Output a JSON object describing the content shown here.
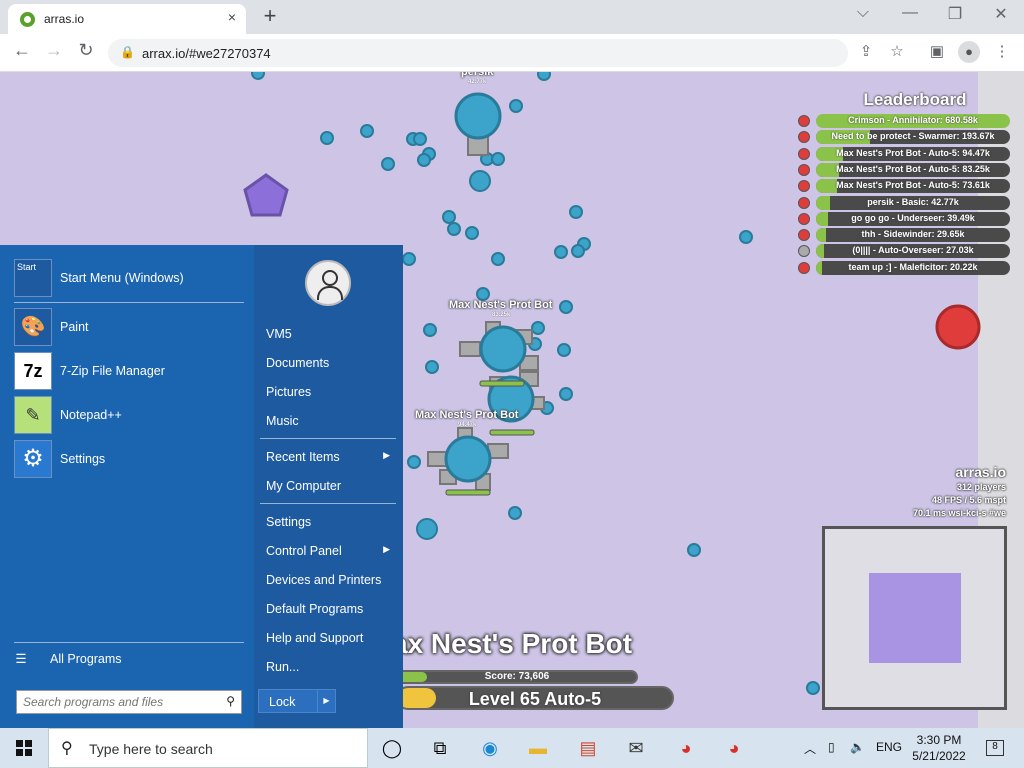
{
  "browser": {
    "tab_title": "arras.io",
    "tab_close": "×",
    "new_tab": "+",
    "url": "arrax.io/#we27270374",
    "window_controls": [
      "⌵",
      "—",
      "❐",
      "✕"
    ]
  },
  "game": {
    "leaderboard": {
      "title": "Leaderboard",
      "entries": [
        {
          "label": "Crimson - Annihilator: 680.58k",
          "fill": 1.0,
          "color": "#e03c3c"
        },
        {
          "label": "Need to be protect - Swarmer: 193.67k",
          "fill": 0.28,
          "color": "#e03c3c"
        },
        {
          "label": "Max Nest's Prot Bot - Auto-5: 94.47k",
          "fill": 0.14,
          "color": "#e03c3c"
        },
        {
          "label": "Max Nest's Prot Bot - Auto-5: 83.25k",
          "fill": 0.12,
          "color": "#e03c3c"
        },
        {
          "label": "Max Nest's Prot Bot - Auto-5: 73.61k",
          "fill": 0.11,
          "color": "#e03c3c"
        },
        {
          "label": "persik - Basic: 42.77k",
          "fill": 0.07,
          "color": "#e03c3c"
        },
        {
          "label": "go go go - Underseer: 39.49k",
          "fill": 0.06,
          "color": "#e03c3c"
        },
        {
          "label": "thh - Sidewinder: 29.65k",
          "fill": 0.05,
          "color": "#e03c3c"
        },
        {
          "label": "(0|||| - Auto-Overseer: 27.03k",
          "fill": 0.04,
          "color": "#aaaaaa"
        },
        {
          "label": "team up :] - Maleficitor: 20.22k",
          "fill": 0.03,
          "color": "#e03c3c"
        }
      ]
    },
    "server": {
      "name": "arras.io",
      "players": "312 players",
      "fps": "48 FPS / 5.6 mspt",
      "latency": "70.1 ms  wsi-kci-s #we"
    },
    "player": {
      "name": "ax Nest's Prot Bot",
      "score": "Score: 73,606",
      "level": "Level 65 Auto-5",
      "score_fill": 0.12,
      "level_fill": 0.14
    },
    "labels": {
      "persik_name": "persik",
      "persik_score": "42.77k",
      "bot1_name": "Max Nest's Prot Bot",
      "bot1_score": "83.25k",
      "bot2_name": "Max Nest's Prot Bot",
      "bot2_score": "94.47k"
    }
  },
  "start_menu": {
    "apps": [
      {
        "label": "Start Menu (Windows)",
        "icon": "start-menu-icon"
      },
      {
        "label": "Paint",
        "icon": "paint-icon"
      },
      {
        "label": "7-Zip File Manager",
        "icon": "7zip-icon"
      },
      {
        "label": "Notepad++",
        "icon": "notepad-icon"
      },
      {
        "label": "Settings",
        "icon": "gear-icon"
      }
    ],
    "start_icon_text": "Start",
    "sevenzip_icon_text": "7z",
    "all_programs": "All Programs",
    "search_placeholder": "Search programs and files",
    "right_items": {
      "user": "VM5",
      "documents": "Documents",
      "pictures": "Pictures",
      "music": "Music",
      "recent": "Recent Items",
      "computer": "My Computer",
      "settings": "Settings",
      "control_panel": "Control Panel",
      "devices": "Devices and Printers",
      "default_programs": "Default Programs",
      "help": "Help and Support",
      "run": "Run..."
    },
    "lock": "Lock"
  },
  "taskbar": {
    "search_text": "Type here to search",
    "lang": "ENG",
    "time": "3:30 PM",
    "date": "5/21/2022",
    "notifications": "8"
  }
}
